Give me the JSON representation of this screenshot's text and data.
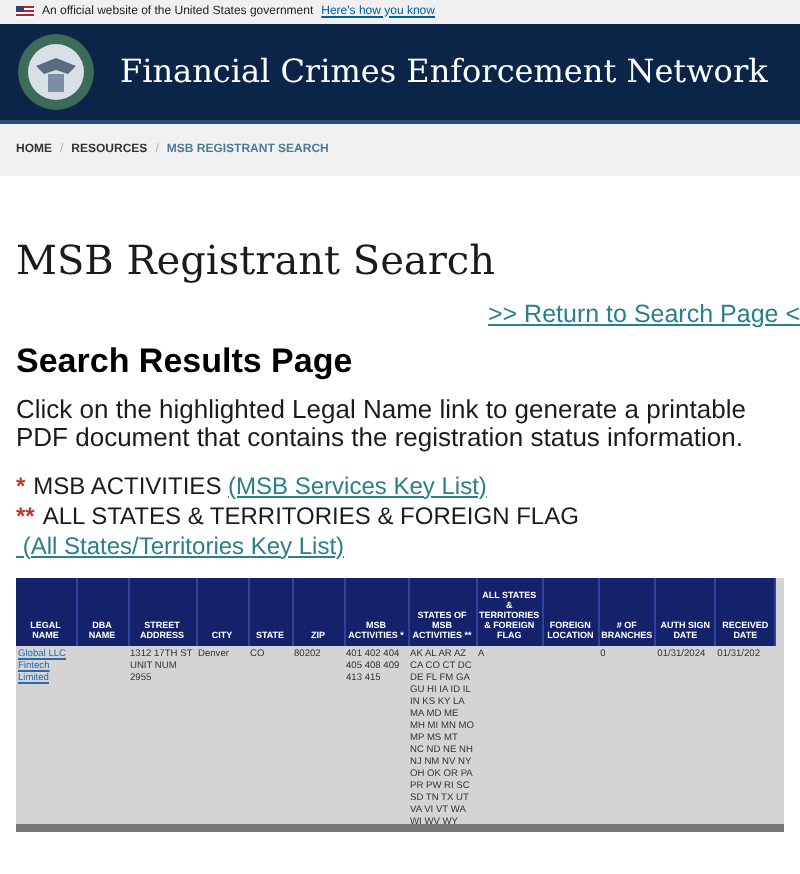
{
  "gov_banner": {
    "text": "An official website of the United States government",
    "link": "Here's how you know"
  },
  "header": {
    "title": "Financial Crimes Enforcement Network"
  },
  "breadcrumb": [
    {
      "label": "HOME",
      "current": false
    },
    {
      "separator": "/",
      "label": "RESOURCES",
      "current": false
    },
    {
      "separator": "/",
      "label": "MSB REGISTRANT SEARCH",
      "current": true
    }
  ],
  "page_title": "MSB Registrant Search",
  "return_link": ">> Return to Search Page <",
  "results_heading": "Search Results Page",
  "intro": "Click on the highlighted Legal Name link to generate a printable PDF document that contains the registration status information.",
  "keys": [
    {
      "marker": "*",
      "label": "MSB ACTIVITIES ",
      "link": "(MSB Services Key List)"
    },
    {
      "marker": "**",
      "label": "ALL STATES & TERRITORIES & FOREIGN FLAG",
      "link": " (All States/Territories Key List)"
    }
  ],
  "table": {
    "columns": [
      "LEGAL NAME",
      "DBA NAME",
      "STREET ADDRESS",
      "CITY",
      "STATE",
      "ZIP",
      "MSB ACTIVITIES *",
      "STATES OF MSB ACTIVITIES **",
      "ALL STATES & TERRITORIES & FOREIGN FLAG",
      "FOREIGN LOCATION",
      "# OF BRANCHES",
      "AUTH SIGN DATE",
      "RECEIVED DATE"
    ],
    "rows": [
      {
        "cells": [
          "Global LLC Fintech Limited",
          "",
          "1312 17TH ST UNIT NUM 2955",
          "Denver",
          "CO",
          "80202",
          "401 402 404 405 408 409 413 415",
          "AK AL AR AZ CA CO CT DC DE FL FM GA GU HI IA ID IL IN KS KY LA MA MD ME MH MI MN MO MP MS MT NC ND NE NH NJ NM NV NY OH OK OR PA PR PW RI SC SD TN TX UT VA VI VT WA WI WV WY",
          "A",
          "",
          "0",
          "01/31/2024",
          "01/31/202"
        ]
      }
    ]
  }
}
